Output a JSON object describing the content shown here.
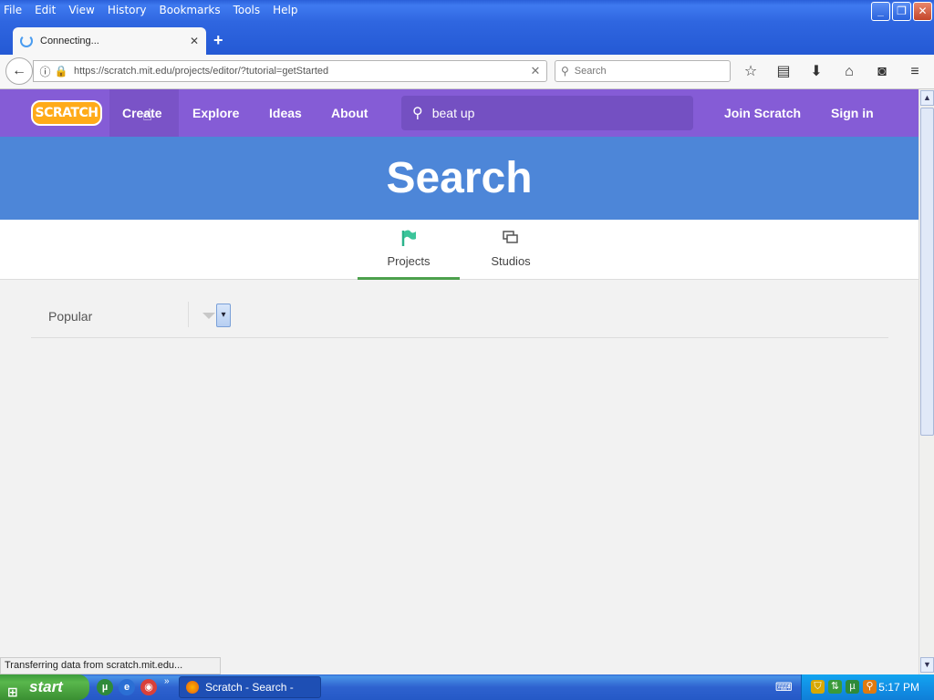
{
  "browser": {
    "menu": [
      "File",
      "Edit",
      "View",
      "History",
      "Bookmarks",
      "Tools",
      "Help"
    ],
    "tab_title": "Connecting...",
    "url": "https://scratch.mit.edu/projects/editor/?tutorial=getStarted",
    "search_placeholder": "Search",
    "status_text": "Transferring data from scratch.mit.edu..."
  },
  "scratch": {
    "logo": "SCRATCH",
    "nav": {
      "create": "Create",
      "explore": "Explore",
      "ideas": "Ideas",
      "about": "About",
      "join": "Join Scratch",
      "signin": "Sign in"
    },
    "search_value": "beat up",
    "banner_title": "Search",
    "tabs": {
      "projects": "Projects",
      "studios": "Studios"
    },
    "sort_label": "Popular"
  },
  "taskbar": {
    "start": "start",
    "task_button": "Scratch - Search - Mo...",
    "clock": "5:17 PM"
  },
  "colors": {
    "scratch_purple": "#855cd6",
    "banner_blue": "#4d86d8",
    "active_tab_underline": "#4ca04c"
  }
}
